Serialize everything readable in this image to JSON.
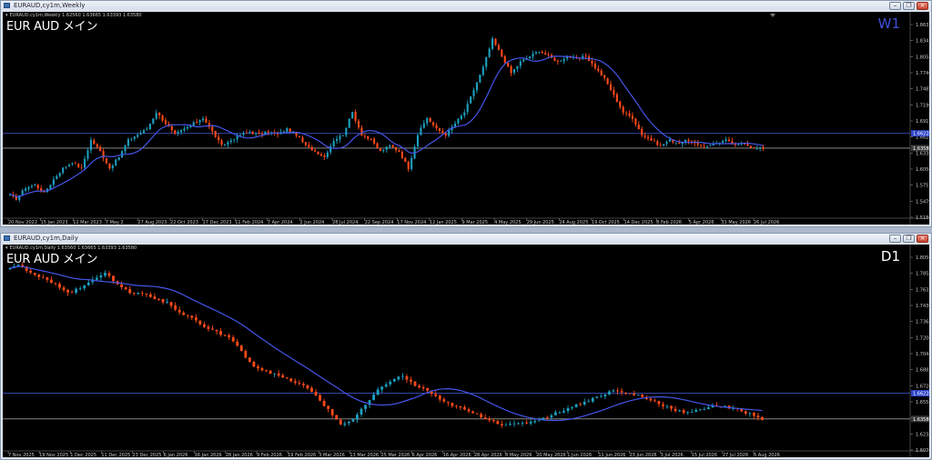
{
  "colors": {
    "bull": "#1c9fbf",
    "bear": "#ff4a1a",
    "ma": "#4456e8",
    "hline": "#3c4fbf",
    "bid_line": "#9a9a9a",
    "tag_blue": "#2f46c9",
    "tag_dark": "#3a3a3a",
    "tf_weekly": "#3f51d8",
    "tf_daily": "#ffffff"
  },
  "windows": [
    {
      "id": "weekly",
      "window_title": "EURAUD,cy1m,Weekly",
      "ohlc_text": "EURAUD.cy1m,Weekly  1.62560 1.63665 1.63393 1.63580",
      "symbol_title": "EUR AUD メイン",
      "timeframe_label": "W1",
      "timeframe_color": "#3f51d8",
      "buttons": [
        "minimize",
        "restore",
        "close"
      ],
      "price_labels": [
        "1.86325",
        "1.83435",
        "1.80545",
        "1.77460",
        "1.74850",
        "1.71960",
        "1.69120",
        "1.66280",
        "1.63380",
        "1.60560",
        "1.57576",
        "1.54790",
        "1.51865"
      ],
      "price_tags": [
        {
          "label": "1.66220",
          "price": 1.6622,
          "style": "blue"
        },
        {
          "label": "1.63580",
          "price": 1.6358,
          "style": "dark"
        }
      ],
      "date_labels": [
        "20 Nov 2022",
        "15 Jan 2023",
        "12 Mar 2023",
        "7 May 2",
        "27 Aug 2023",
        "22 Oct 2023",
        "17 Dec 2023",
        "11 Feb 2024",
        "7 Apr 2024",
        "2 Jun 2024",
        "28 Jul 2024",
        "22 Sep 2024",
        "17 Nov 2024",
        "12 Jan 2025",
        "9 Mar 2025",
        "4 May 2025",
        "29 Jun 2025",
        "24 Aug 2025",
        "19 Oct 2025",
        "14 Dec 2025",
        "8 Feb 2026",
        "5 Apr 2026",
        "31 May 2026",
        "26 Jul 2026"
      ],
      "chart_data": {
        "type": "candlestick",
        "price_range": [
          1.51865,
          1.86325
        ],
        "path": [
          1.555,
          1.545,
          1.565,
          1.57,
          1.555,
          1.58,
          1.6,
          1.61,
          1.6,
          1.65,
          1.63,
          1.6,
          1.62,
          1.65,
          1.66,
          1.67,
          1.7,
          1.68,
          1.66,
          1.67,
          1.68,
          1.69,
          1.665,
          1.64,
          1.65,
          1.66,
          1.665,
          1.66,
          1.665,
          1.66,
          1.67,
          1.66,
          1.64,
          1.63,
          1.62,
          1.65,
          1.66,
          1.7,
          1.66,
          1.65,
          1.63,
          1.64,
          1.63,
          1.6,
          1.66,
          1.69,
          1.67,
          1.66,
          1.68,
          1.7,
          1.74,
          1.78,
          1.83,
          1.8,
          1.77,
          1.79,
          1.8,
          1.81,
          1.8,
          1.79,
          1.8,
          1.795,
          1.8,
          1.78,
          1.76,
          1.73,
          1.7,
          1.69,
          1.66,
          1.65,
          1.64,
          1.65,
          1.645,
          1.65,
          1.64,
          1.64,
          1.645,
          1.65,
          1.64,
          1.645,
          1.635,
          1.636
        ],
        "ma_period": 12
      }
    },
    {
      "id": "daily",
      "window_title": "EURAUD,cy1m,Daily",
      "ohlc_text": "EURAUD.cy1m,Daily  1.63560 1.63665 1.63393 1.63580",
      "symbol_title": "EUR AUD メイン",
      "timeframe_label": "D1",
      "timeframe_color": "#ffffff",
      "buttons": [
        "minimize",
        "restore",
        "close"
      ],
      "price_labels": [
        "1.80560",
        "1.78540",
        "1.76320",
        "1.74300",
        "1.73680",
        "1.72060",
        "1.70440",
        "1.68820",
        "1.67200",
        "1.65580",
        "1.63960",
        "1.62385",
        "1.60760"
      ],
      "price_tags": [
        {
          "label": "1.66220",
          "price": 1.6622,
          "style": "blue"
        },
        {
          "label": "1.63580",
          "price": 1.6358,
          "style": "dark"
        }
      ],
      "date_labels": [
        "7 Nov 2025",
        "19 Nov 2025",
        "1 Dec 2025",
        "11 Dec 2025",
        "23 Dec 2025",
        "6 Jan 2026",
        "16 Jan 2026",
        "28 Jan 2026",
        "9 Feb 2026",
        "19 Feb 2026",
        "3 Mar 2026",
        "13 Mar 2026",
        "25 Mar 2026",
        "6 Apr 2026",
        "16 Apr 2026",
        "28 Apr 2026",
        "8 May 2026",
        "20 May 2026",
        "1 Jun 2026",
        "11 Jun 2026",
        "23 Jun 2026",
        "3 Jul 2026",
        "15 Jul 2026",
        "27 Jul 2026",
        "6 Aug 2026"
      ],
      "chart_data": {
        "type": "candlestick",
        "price_range": [
          1.6076,
          1.8056
        ],
        "path": [
          1.79,
          1.795,
          1.785,
          1.78,
          1.775,
          1.765,
          1.77,
          1.78,
          1.785,
          1.775,
          1.765,
          1.765,
          1.76,
          1.755,
          1.745,
          1.74,
          1.73,
          1.725,
          1.72,
          1.705,
          1.69,
          1.685,
          1.68,
          1.675,
          1.67,
          1.66,
          1.645,
          1.63,
          1.635,
          1.65,
          1.665,
          1.675,
          1.68,
          1.67,
          1.665,
          1.655,
          1.65,
          1.645,
          1.64,
          1.635,
          1.63,
          1.63,
          1.632,
          1.635,
          1.64,
          1.645,
          1.65,
          1.655,
          1.66,
          1.665,
          1.662,
          1.66,
          1.655,
          1.65,
          1.645,
          1.642,
          1.645,
          1.65,
          1.648,
          1.645,
          1.641,
          1.636
        ],
        "ma_period": 20
      }
    }
  ]
}
